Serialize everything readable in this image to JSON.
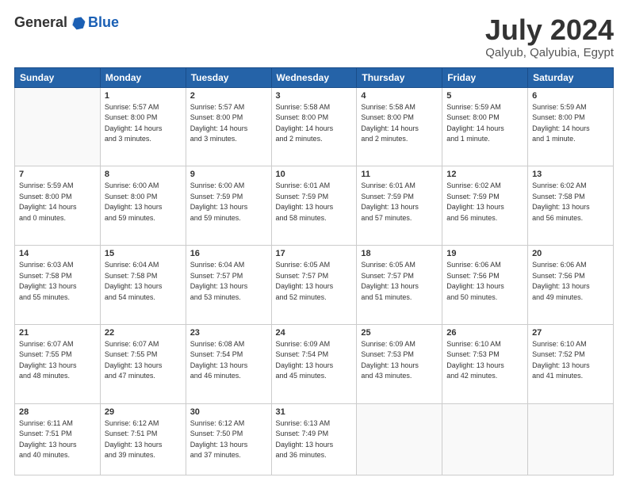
{
  "logo": {
    "general": "General",
    "blue": "Blue"
  },
  "header": {
    "month_year": "July 2024",
    "location": "Qalyub, Qalyubia, Egypt"
  },
  "weekdays": [
    "Sunday",
    "Monday",
    "Tuesday",
    "Wednesday",
    "Thursday",
    "Friday",
    "Saturday"
  ],
  "weeks": [
    [
      {
        "day": "",
        "info": ""
      },
      {
        "day": "1",
        "info": "Sunrise: 5:57 AM\nSunset: 8:00 PM\nDaylight: 14 hours\nand 3 minutes."
      },
      {
        "day": "2",
        "info": "Sunrise: 5:57 AM\nSunset: 8:00 PM\nDaylight: 14 hours\nand 3 minutes."
      },
      {
        "day": "3",
        "info": "Sunrise: 5:58 AM\nSunset: 8:00 PM\nDaylight: 14 hours\nand 2 minutes."
      },
      {
        "day": "4",
        "info": "Sunrise: 5:58 AM\nSunset: 8:00 PM\nDaylight: 14 hours\nand 2 minutes."
      },
      {
        "day": "5",
        "info": "Sunrise: 5:59 AM\nSunset: 8:00 PM\nDaylight: 14 hours\nand 1 minute."
      },
      {
        "day": "6",
        "info": "Sunrise: 5:59 AM\nSunset: 8:00 PM\nDaylight: 14 hours\nand 1 minute."
      }
    ],
    [
      {
        "day": "7",
        "info": "Sunrise: 5:59 AM\nSunset: 8:00 PM\nDaylight: 14 hours\nand 0 minutes."
      },
      {
        "day": "8",
        "info": "Sunrise: 6:00 AM\nSunset: 8:00 PM\nDaylight: 13 hours\nand 59 minutes."
      },
      {
        "day": "9",
        "info": "Sunrise: 6:00 AM\nSunset: 7:59 PM\nDaylight: 13 hours\nand 59 minutes."
      },
      {
        "day": "10",
        "info": "Sunrise: 6:01 AM\nSunset: 7:59 PM\nDaylight: 13 hours\nand 58 minutes."
      },
      {
        "day": "11",
        "info": "Sunrise: 6:01 AM\nSunset: 7:59 PM\nDaylight: 13 hours\nand 57 minutes."
      },
      {
        "day": "12",
        "info": "Sunrise: 6:02 AM\nSunset: 7:59 PM\nDaylight: 13 hours\nand 56 minutes."
      },
      {
        "day": "13",
        "info": "Sunrise: 6:02 AM\nSunset: 7:58 PM\nDaylight: 13 hours\nand 56 minutes."
      }
    ],
    [
      {
        "day": "14",
        "info": "Sunrise: 6:03 AM\nSunset: 7:58 PM\nDaylight: 13 hours\nand 55 minutes."
      },
      {
        "day": "15",
        "info": "Sunrise: 6:04 AM\nSunset: 7:58 PM\nDaylight: 13 hours\nand 54 minutes."
      },
      {
        "day": "16",
        "info": "Sunrise: 6:04 AM\nSunset: 7:57 PM\nDaylight: 13 hours\nand 53 minutes."
      },
      {
        "day": "17",
        "info": "Sunrise: 6:05 AM\nSunset: 7:57 PM\nDaylight: 13 hours\nand 52 minutes."
      },
      {
        "day": "18",
        "info": "Sunrise: 6:05 AM\nSunset: 7:57 PM\nDaylight: 13 hours\nand 51 minutes."
      },
      {
        "day": "19",
        "info": "Sunrise: 6:06 AM\nSunset: 7:56 PM\nDaylight: 13 hours\nand 50 minutes."
      },
      {
        "day": "20",
        "info": "Sunrise: 6:06 AM\nSunset: 7:56 PM\nDaylight: 13 hours\nand 49 minutes."
      }
    ],
    [
      {
        "day": "21",
        "info": "Sunrise: 6:07 AM\nSunset: 7:55 PM\nDaylight: 13 hours\nand 48 minutes."
      },
      {
        "day": "22",
        "info": "Sunrise: 6:07 AM\nSunset: 7:55 PM\nDaylight: 13 hours\nand 47 minutes."
      },
      {
        "day": "23",
        "info": "Sunrise: 6:08 AM\nSunset: 7:54 PM\nDaylight: 13 hours\nand 46 minutes."
      },
      {
        "day": "24",
        "info": "Sunrise: 6:09 AM\nSunset: 7:54 PM\nDaylight: 13 hours\nand 45 minutes."
      },
      {
        "day": "25",
        "info": "Sunrise: 6:09 AM\nSunset: 7:53 PM\nDaylight: 13 hours\nand 43 minutes."
      },
      {
        "day": "26",
        "info": "Sunrise: 6:10 AM\nSunset: 7:53 PM\nDaylight: 13 hours\nand 42 minutes."
      },
      {
        "day": "27",
        "info": "Sunrise: 6:10 AM\nSunset: 7:52 PM\nDaylight: 13 hours\nand 41 minutes."
      }
    ],
    [
      {
        "day": "28",
        "info": "Sunrise: 6:11 AM\nSunset: 7:51 PM\nDaylight: 13 hours\nand 40 minutes."
      },
      {
        "day": "29",
        "info": "Sunrise: 6:12 AM\nSunset: 7:51 PM\nDaylight: 13 hours\nand 39 minutes."
      },
      {
        "day": "30",
        "info": "Sunrise: 6:12 AM\nSunset: 7:50 PM\nDaylight: 13 hours\nand 37 minutes."
      },
      {
        "day": "31",
        "info": "Sunrise: 6:13 AM\nSunset: 7:49 PM\nDaylight: 13 hours\nand 36 minutes."
      },
      {
        "day": "",
        "info": ""
      },
      {
        "day": "",
        "info": ""
      },
      {
        "day": "",
        "info": ""
      }
    ]
  ]
}
